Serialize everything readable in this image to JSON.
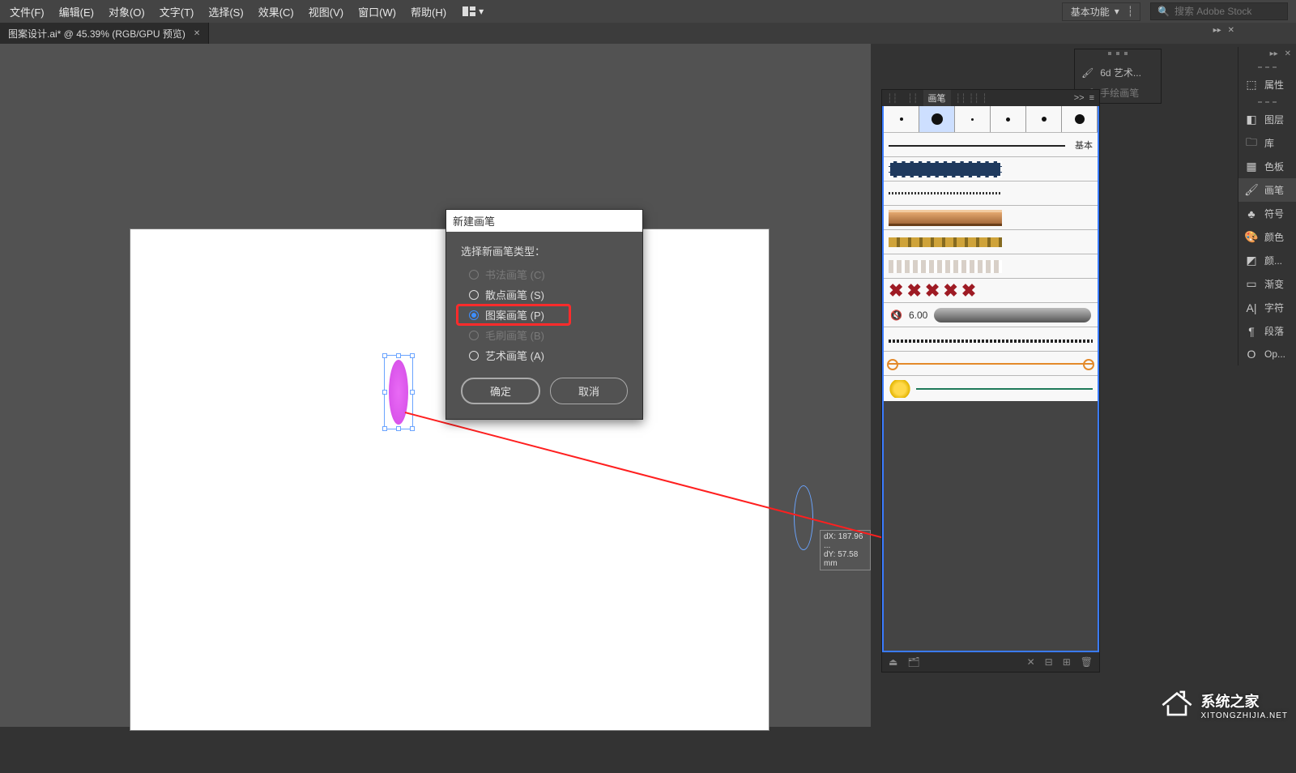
{
  "menubar": {
    "items": [
      "文件(F)",
      "编辑(E)",
      "对象(O)",
      "文字(T)",
      "选择(S)",
      "效果(C)",
      "视图(V)",
      "窗口(W)",
      "帮助(H)"
    ]
  },
  "workspace": {
    "label": "基本功能"
  },
  "search": {
    "placeholder": "搜索 Adobe Stock"
  },
  "tab": {
    "label": "图案设计.ai* @ 45.39% (RGB/GPU 预览)"
  },
  "dialog": {
    "title": "新建画笔",
    "prompt": "选择新画笔类型：",
    "options": {
      "calligraphy": "书法画笔 (C)",
      "scatter": "散点画笔 (S)",
      "pattern": "图案画笔 (P)",
      "bristle": "毛刷画笔 (B)",
      "art": "艺术画笔 (A)"
    },
    "ok": "确定",
    "cancel": "取消"
  },
  "drag_tip": {
    "dx": "dX: 187.96 ...",
    "dy": "dY: 57.58 mm"
  },
  "mini_lib": {
    "item1": "6d 艺术...",
    "item2": "手绘画笔"
  },
  "brush_tabs": {
    "active": "画笔",
    "basic_label": "基本"
  },
  "brush_value_row": {
    "num": "6.00"
  },
  "rail": {
    "items": [
      "属性",
      "图层",
      "库",
      "色板",
      "画笔",
      "符号",
      "颜色",
      "颜...",
      "渐变",
      "字符",
      "段落",
      "Op..."
    ]
  },
  "watermark": {
    "name": "系统之家",
    "url": "XITONGZHIJIA.NET"
  }
}
